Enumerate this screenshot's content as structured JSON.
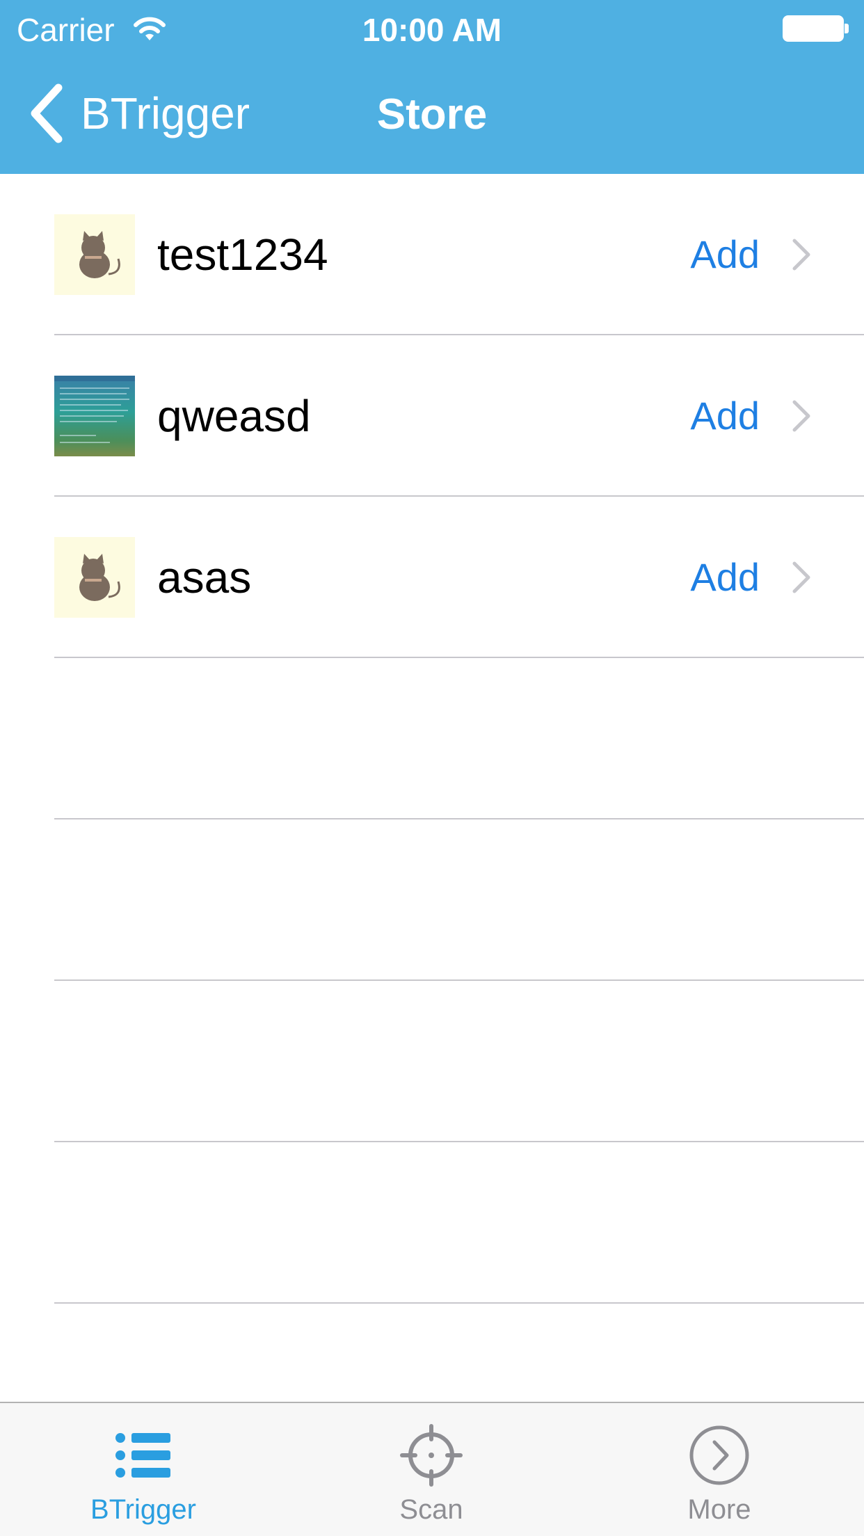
{
  "status": {
    "carrier": "Carrier",
    "time": "10:00 AM"
  },
  "navbar": {
    "back_label": "BTrigger",
    "title": "Store"
  },
  "items": [
    {
      "name": "test1234",
      "action": "Add",
      "thumbnail": "cat-icon"
    },
    {
      "name": "qweasd",
      "action": "Add",
      "thumbnail": "screenshot-thumbnail"
    },
    {
      "name": "asas",
      "action": "Add",
      "thumbnail": "cat-icon"
    }
  ],
  "tabs": [
    {
      "label": "BTrigger",
      "icon": "list-icon",
      "selected": true
    },
    {
      "label": "Scan",
      "icon": "crosshair-icon",
      "selected": false
    },
    {
      "label": "More",
      "icon": "chevron-circle-icon",
      "selected": false
    }
  ],
  "colors": {
    "navbar": "#4fb0e2",
    "accent": "#1e7fe3",
    "tab_selected": "#2a9ee0",
    "tab_unselected": "#8e8e93"
  }
}
